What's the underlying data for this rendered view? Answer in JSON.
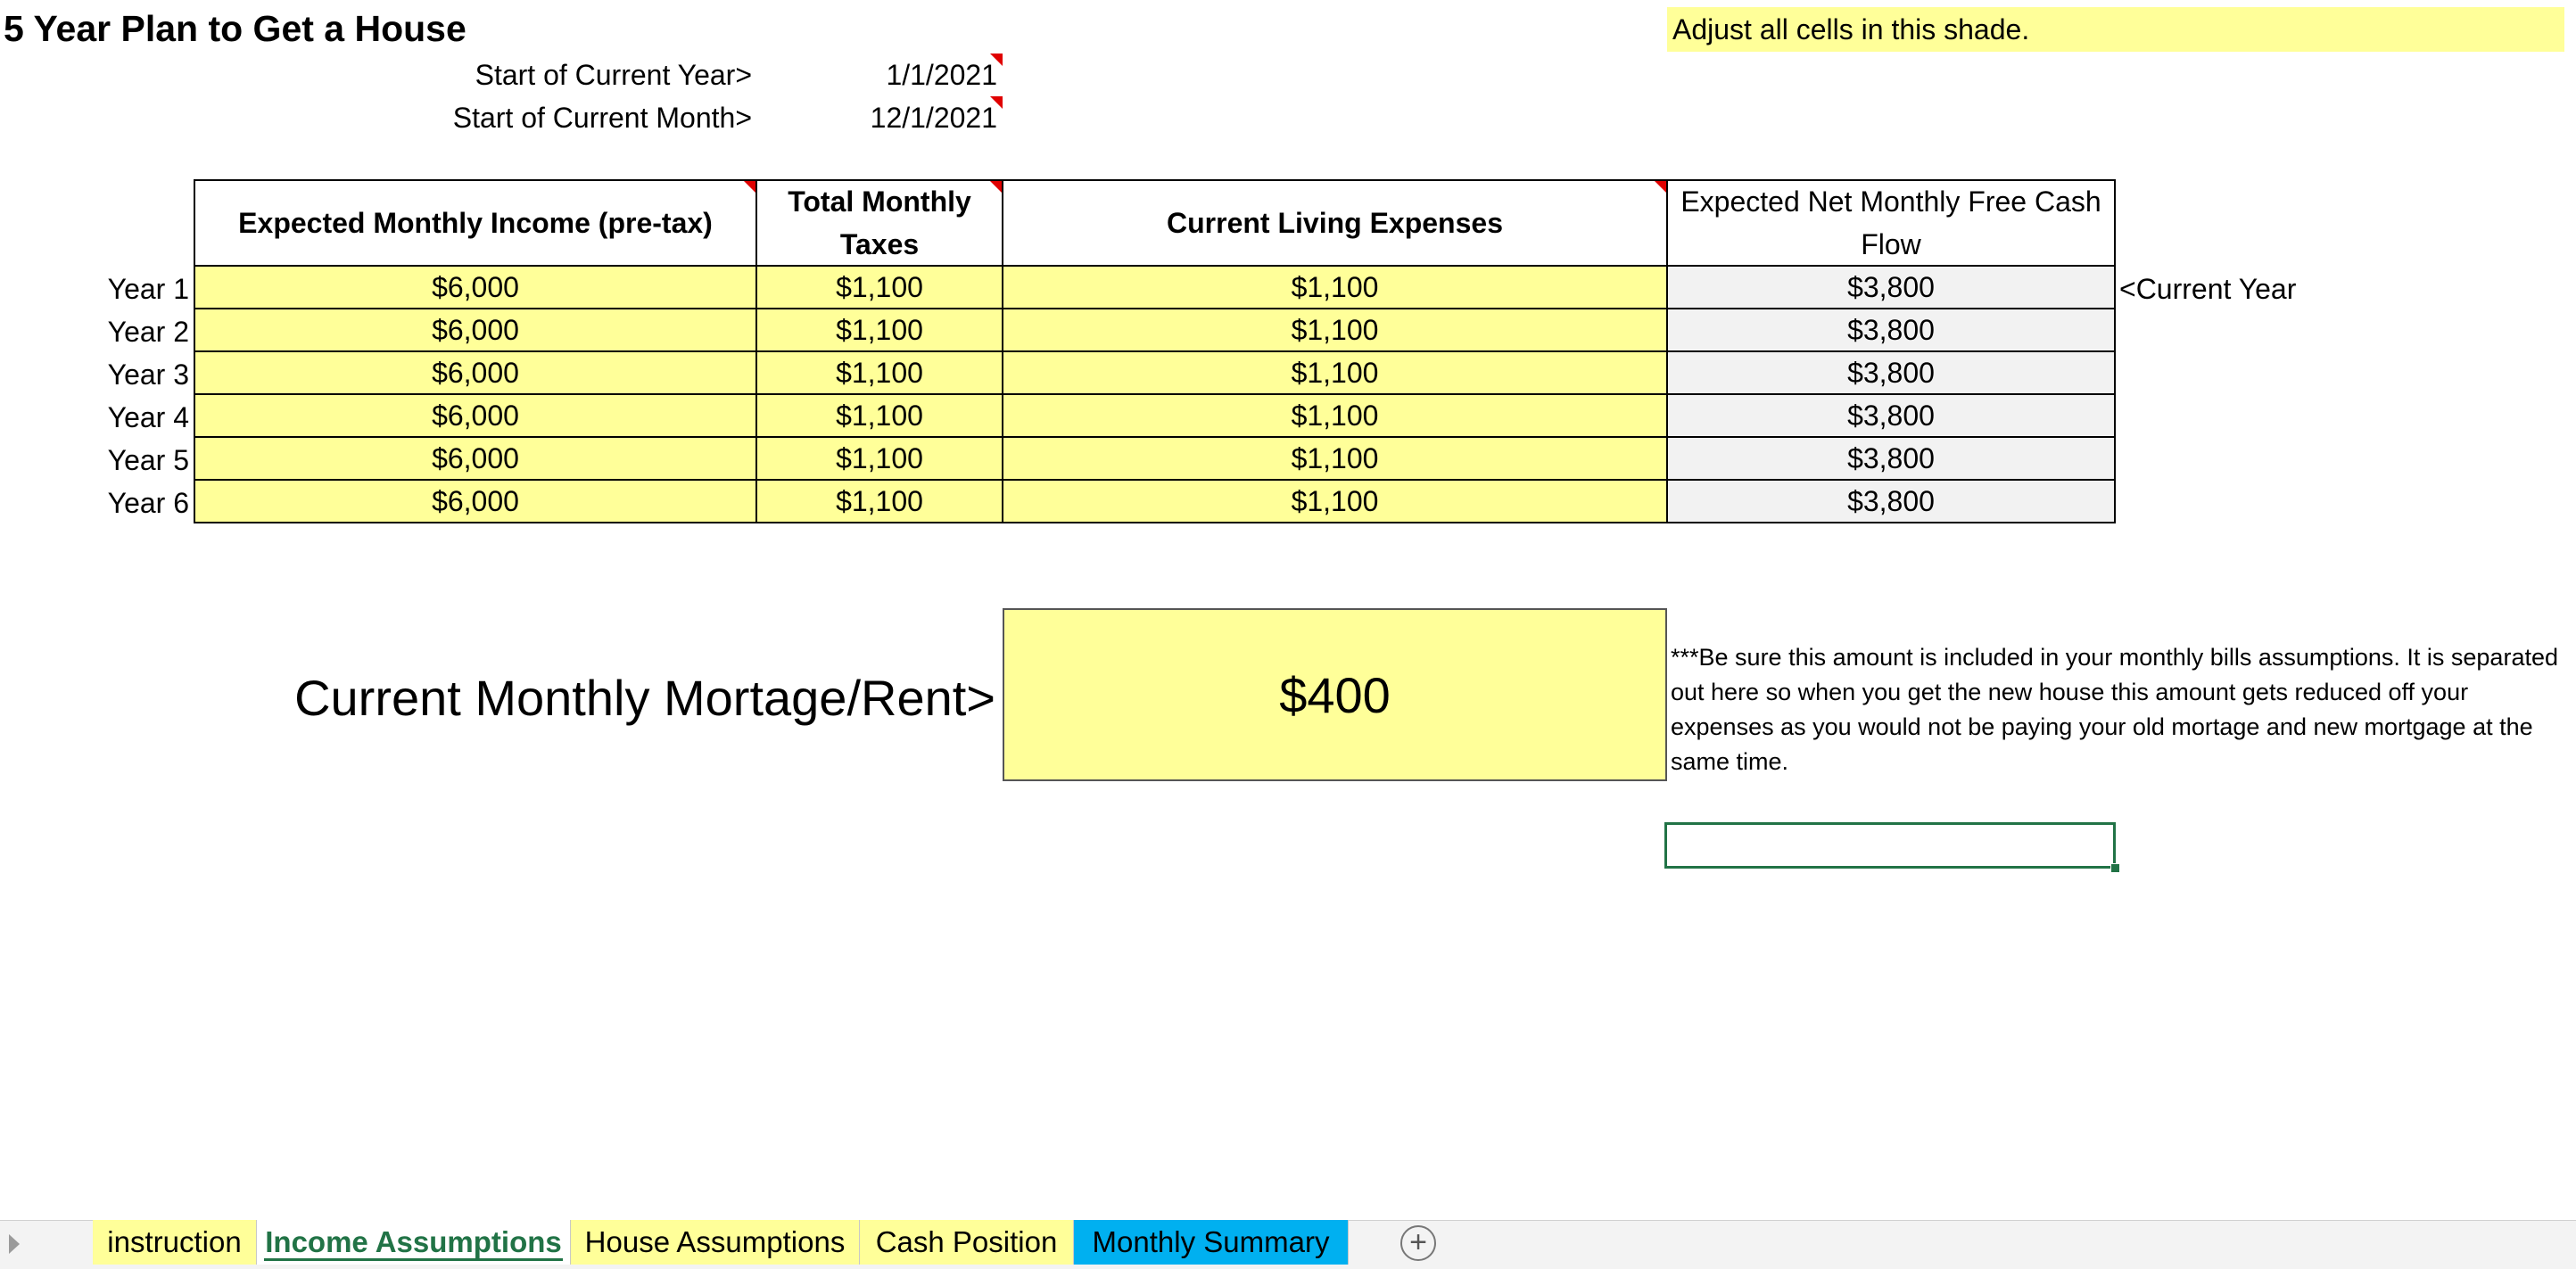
{
  "title": "5 Year Plan to Get a House",
  "legend": "Adjust all cells in this shade.",
  "start_year": {
    "label": "Start of Current Year>",
    "value": "1/1/2021"
  },
  "start_month": {
    "label": "Start of Current Month>",
    "value": "12/1/2021"
  },
  "table": {
    "headers": {
      "income": "Expected Monthly Income (pre-tax)",
      "taxes": "Total Monthly Taxes",
      "expenses": "Current Living Expenses",
      "net": "Expected Net Monthly Free Cash Flow"
    },
    "rows": [
      {
        "label": "Year 1",
        "income": "$6,000",
        "taxes": "$1,100",
        "expenses": "$1,100",
        "net": "$3,800"
      },
      {
        "label": "Year 2",
        "income": "$6,000",
        "taxes": "$1,100",
        "expenses": "$1,100",
        "net": "$3,800"
      },
      {
        "label": "Year 3",
        "income": "$6,000",
        "taxes": "$1,100",
        "expenses": "$1,100",
        "net": "$3,800"
      },
      {
        "label": "Year 4",
        "income": "$6,000",
        "taxes": "$1,100",
        "expenses": "$1,100",
        "net": "$3,800"
      },
      {
        "label": "Year 5",
        "income": "$6,000",
        "taxes": "$1,100",
        "expenses": "$1,100",
        "net": "$3,800"
      },
      {
        "label": "Year 6",
        "income": "$6,000",
        "taxes": "$1,100",
        "expenses": "$1,100",
        "net": "$3,800"
      }
    ],
    "current_year_marker": "<Current Year"
  },
  "mortgage": {
    "label": "Current Monthly Mortage/Rent>",
    "value": "$400",
    "note": "***Be sure this amount is included in your monthly bills assumptions. It is separated out here so when you get the new house this amount gets reduced off your expenses as you would not be paying your old mortage and new mortgage at the same time."
  },
  "tabs": [
    {
      "label": "instruction",
      "color": "#ffff99"
    },
    {
      "label": "Income Assumptions",
      "color": "#ffffff",
      "active": true
    },
    {
      "label": "House Assumptions",
      "color": "#ffff99"
    },
    {
      "label": "Cash Position",
      "color": "#ffff99"
    },
    {
      "label": "Monthly Summary",
      "color": "#00b0f0"
    }
  ],
  "colors": {
    "input_shade": "#ffff99",
    "calc_shade": "#f2f2f2",
    "active_tab_text": "#217346",
    "comment_marker": "#e00000"
  }
}
